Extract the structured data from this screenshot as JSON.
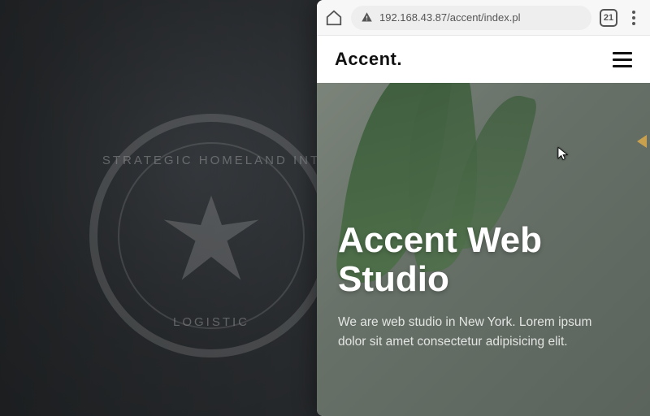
{
  "wallpaper": {
    "seal_top_text": "STRATEGIC HOMELAND INT",
    "seal_bottom_text": "LOGISTIC"
  },
  "browser": {
    "url": "192.168.43.87/accent/index.pl",
    "tab_count": "21"
  },
  "site": {
    "brand": "Accent",
    "brand_suffix": ".",
    "hero_title": "Accent Web Studio",
    "hero_subtitle": "We are web studio in New York. Lorem ipsum dolor sit amet consectetur adipisicing elit."
  }
}
